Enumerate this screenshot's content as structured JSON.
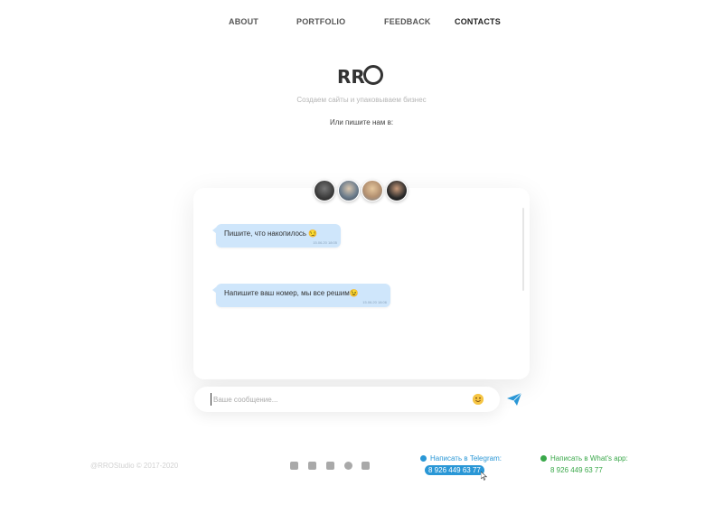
{
  "nav": {
    "items": [
      {
        "label": "ABOUT"
      },
      {
        "label": "PORTFOLIO"
      },
      {
        "label": "FEEDBACK"
      },
      {
        "label": "CONTACTS"
      }
    ]
  },
  "brand": {
    "logo_text": "RR",
    "tagline": "Создаем сайты и упаковываем бизнес",
    "subtitle": "Или пишите нам в:"
  },
  "chat": {
    "messages": [
      {
        "text": "Пишите, что накопилось 😏",
        "time": "15.06.20 18:05"
      },
      {
        "text": "Напишите ваш номер, мы все решим😉",
        "time": "15.06.20 18:06"
      }
    ],
    "input": {
      "placeholder": "Ваше сообщение..."
    },
    "emoji_icon": "smile-emoji-icon",
    "send_icon": "paper-plane-icon"
  },
  "footer": {
    "copyright": "@RROStudio  © 2017-2020",
    "social": [
      "telegram-icon",
      "behance-icon",
      "vk-icon",
      "whatsapp-icon",
      "instagram-icon"
    ],
    "telegram": {
      "label": "Написать в Telegram:",
      "phone": "8 926 449 63 77"
    },
    "whatsapp": {
      "label": "Написать в What's app:",
      "phone": "8 926 449 63 77"
    }
  },
  "colors": {
    "accent": "#2a97d6",
    "whatsapp": "#3aa84a",
    "bubble": "#cfe6fb"
  }
}
